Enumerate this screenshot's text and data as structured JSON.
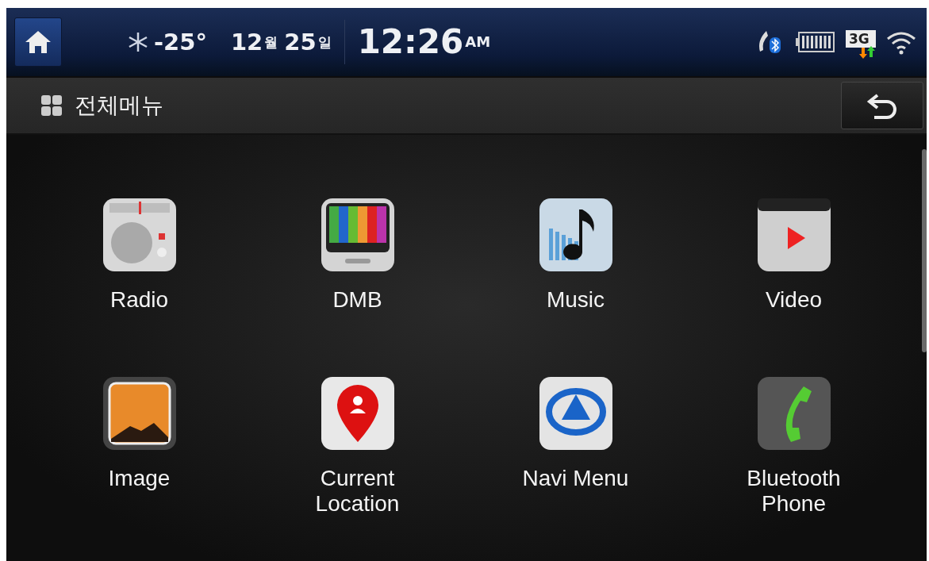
{
  "status_bar": {
    "temperature": "-25°",
    "month": "12",
    "month_unit": "월",
    "day": "25",
    "day_unit": "일",
    "time": "12:26",
    "meridiem": "AM",
    "network": "3G"
  },
  "header": {
    "title": "전체메뉴"
  },
  "menu_items": [
    {
      "kind": "radio",
      "label": "Radio"
    },
    {
      "kind": "dmb",
      "label": "DMB"
    },
    {
      "kind": "music",
      "label": "Music"
    },
    {
      "kind": "video",
      "label": "Video"
    },
    {
      "kind": "image",
      "label": "Image"
    },
    {
      "kind": "location",
      "label": "Current\nLocation"
    },
    {
      "kind": "navi",
      "label": "Navi Menu"
    },
    {
      "kind": "phone",
      "label": "Bluetooth\nPhone"
    }
  ]
}
